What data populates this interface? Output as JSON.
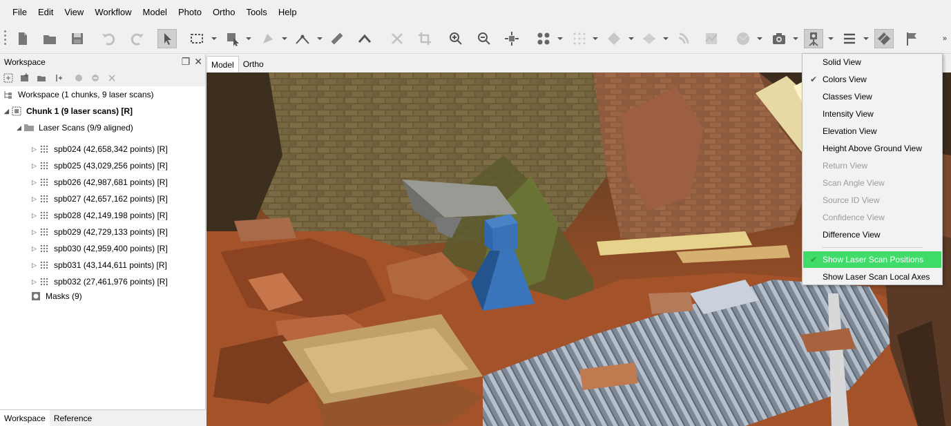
{
  "menubar": {
    "items": [
      "File",
      "Edit",
      "View",
      "Workflow",
      "Model",
      "Photo",
      "Ortho",
      "Tools",
      "Help"
    ]
  },
  "toolbar": {
    "icons": [
      "new-document-icon",
      "open-folder-icon",
      "save-icon",
      "undo-icon",
      "redo-icon",
      "navigation-icon",
      "rectangle-selection-icon",
      "move-object-icon",
      "draw-shape-icon",
      "ruler-icon",
      "draw-polyline-icon",
      "delete-icon",
      "crop-icon",
      "zoom-in-icon",
      "zoom-out-icon",
      "reset-view-icon",
      "point-cloud-icon",
      "points-icon",
      "model-shaded-icon",
      "model-solid-icon",
      "tiled-model-icon",
      "dem-icon",
      "ortho-icon",
      "globe-icon",
      "camera-icon",
      "laser-scanner-icon",
      "menu-icon",
      "flag-icon"
    ],
    "more": "»"
  },
  "workspace": {
    "title": "Workspace",
    "root": "Workspace (1 chunks, 9 laser scans)",
    "chunk": "Chunk 1 (9 laser scans) [R]",
    "folder": "Laser Scans (9/9 aligned)",
    "scans": [
      "spb024 (42,658,342 points) [R]",
      "spb025 (43,029,256 points) [R]",
      "spb026 (42,987,681 points) [R]",
      "spb027 (42,657,162 points) [R]",
      "spb028 (42,149,198 points) [R]",
      "spb029 (42,729,133 points) [R]",
      "spb030 (42,959,400 points) [R]",
      "spb031 (43,144,611 points) [R]",
      "spb032 (27,461,976 points) [R]"
    ],
    "masks": "Masks (9)"
  },
  "bottom_tabs": [
    "Workspace",
    "Reference"
  ],
  "view_tabs": [
    "Model",
    "Ortho"
  ],
  "view_menu": {
    "items": [
      {
        "label": "Solid View",
        "checked": false,
        "enabled": true
      },
      {
        "label": "Colors View",
        "checked": true,
        "enabled": true
      },
      {
        "label": "Classes View",
        "checked": false,
        "enabled": true
      },
      {
        "label": "Intensity View",
        "checked": false,
        "enabled": true
      },
      {
        "label": "Elevation View",
        "checked": false,
        "enabled": true
      },
      {
        "label": "Height Above Ground View",
        "checked": false,
        "enabled": true
      },
      {
        "label": "Return View",
        "checked": false,
        "enabled": false
      },
      {
        "label": "Scan Angle View",
        "checked": false,
        "enabled": false
      },
      {
        "label": "Source ID View",
        "checked": false,
        "enabled": false
      },
      {
        "label": "Confidence View",
        "checked": false,
        "enabled": false
      },
      {
        "label": "Difference View",
        "checked": false,
        "enabled": true
      },
      {
        "label": "Show Laser Scan Positions",
        "checked": true,
        "enabled": true,
        "highlighted": true
      },
      {
        "label": "Show Laser Scan Local Axes",
        "checked": false,
        "enabled": true
      }
    ],
    "highlight_color": "#3fdc6a"
  },
  "colors": {
    "scan_marker": "#3a6fb5",
    "highlight": "#3fdc6a"
  }
}
